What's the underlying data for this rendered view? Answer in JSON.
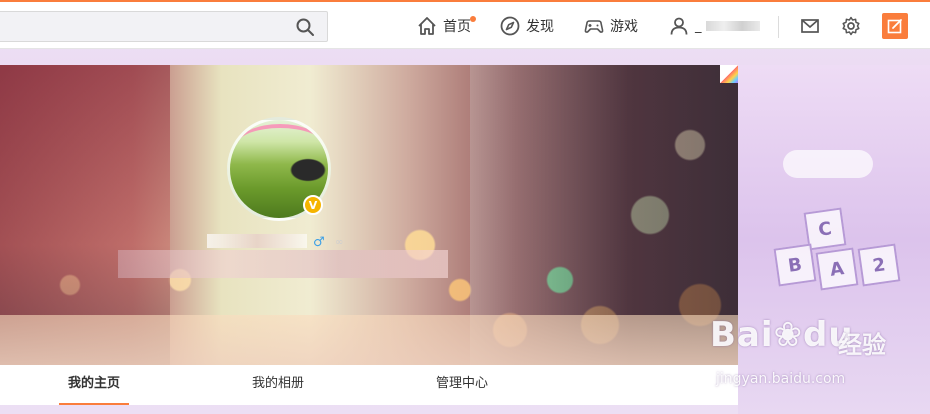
{
  "topbar": {
    "search": {
      "value": "",
      "placeholder": ""
    },
    "nav": {
      "home": "首页",
      "discover": "发现",
      "games": "游戏",
      "user_prefix": "_"
    }
  },
  "profile": {
    "verified_badge": "V",
    "gender_symbol": "♂",
    "member_symbol": "∞"
  },
  "tabs": [
    {
      "label": "我的主页",
      "active": true
    },
    {
      "label": "我的相册",
      "active": false
    },
    {
      "label": "管理中心",
      "active": false
    }
  ],
  "decoration": {
    "blocks": [
      "C",
      "B",
      "A",
      "2"
    ]
  },
  "watermark": {
    "brand": "Bai",
    "brand_suffix": "du",
    "cn": "经验",
    "url": "jingyan.baidu.com"
  },
  "colors": {
    "accent": "#fa7d3c",
    "gender": "#3ca0e6",
    "verified": "#f5b400"
  }
}
